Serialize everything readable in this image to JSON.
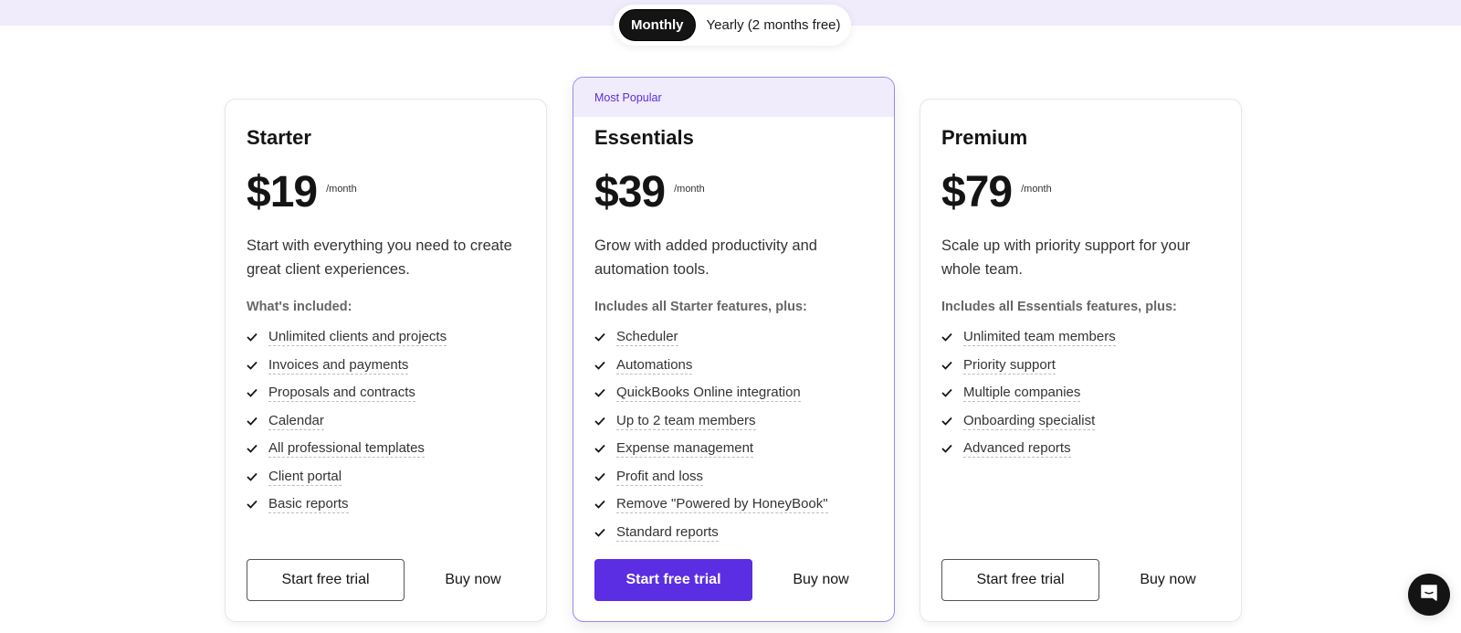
{
  "billing_toggle": {
    "options": [
      {
        "label": "Monthly",
        "active": true
      },
      {
        "label": "Yearly (2 months free)",
        "active": false
      }
    ]
  },
  "colors": {
    "accent": "#5b2ee3",
    "band": "#f0ecfc",
    "popular_text": "#5a2fe0",
    "dark": "#141414"
  },
  "plans": [
    {
      "name": "Starter",
      "price": "$19",
      "period": "/month",
      "description": "Start with everything you need to create great client experiences.",
      "included_label": "What's included:",
      "features": [
        "Unlimited clients and projects",
        "Invoices and payments",
        "Proposals and contracts",
        "Calendar",
        "All professional templates",
        "Client portal",
        "Basic reports"
      ],
      "trial_label": "Start free trial",
      "buy_label": "Buy now"
    },
    {
      "badge": "Most Popular",
      "name": "Essentials",
      "price": "$39",
      "period": "/month",
      "description": "Grow with added productivity and automation tools.",
      "included_label": "Includes all Starter features, plus:",
      "features": [
        "Scheduler",
        "Automations",
        "QuickBooks Online integration",
        "Up to 2 team members",
        "Expense management",
        "Profit and loss",
        "Remove \"Powered by HoneyBook\"",
        "Standard reports"
      ],
      "trial_label": "Start free trial",
      "buy_label": "Buy now"
    },
    {
      "name": "Premium",
      "price": "$79",
      "period": "/month",
      "description": "Scale up with priority support for your whole team.",
      "included_label": "Includes all Essentials features, plus:",
      "features": [
        "Unlimited team members",
        "Priority support",
        "Multiple companies",
        "Onboarding specialist",
        "Advanced reports"
      ],
      "trial_label": "Start free trial",
      "buy_label": "Buy now"
    }
  ],
  "icons": {
    "feature_check": "check-icon",
    "chat": "chat-bubble-icon"
  }
}
